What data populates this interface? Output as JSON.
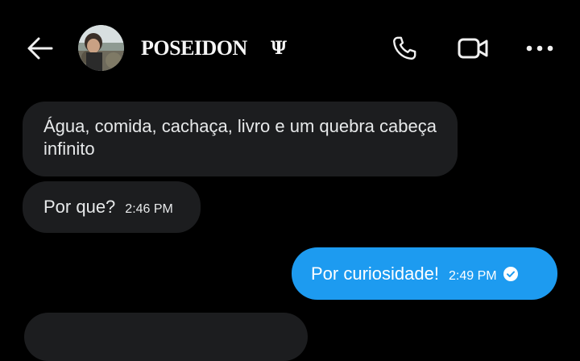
{
  "header": {
    "back_icon": "back-arrow-icon",
    "contact_name": "POSEIDON",
    "name_symbol": "Ψ",
    "call_icon": "phone-icon",
    "video_icon": "video-camera-icon",
    "more_icon": "more-dots-icon"
  },
  "messages": [
    {
      "direction": "incoming",
      "text": "Água, comida, cachaça, livro e um quebra cabeça infinito",
      "time": ""
    },
    {
      "direction": "incoming",
      "text": "Por que?",
      "time": "2:46 PM"
    },
    {
      "direction": "outgoing",
      "text": "Por curiosidade!",
      "time": "2:49 PM",
      "status_icon": "read-check-icon"
    }
  ],
  "colors": {
    "background": "#000000",
    "incoming_bubble": "#1c1d1f",
    "outgoing_bubble": "#1d9bf0",
    "text": "#e7e9ea"
  }
}
